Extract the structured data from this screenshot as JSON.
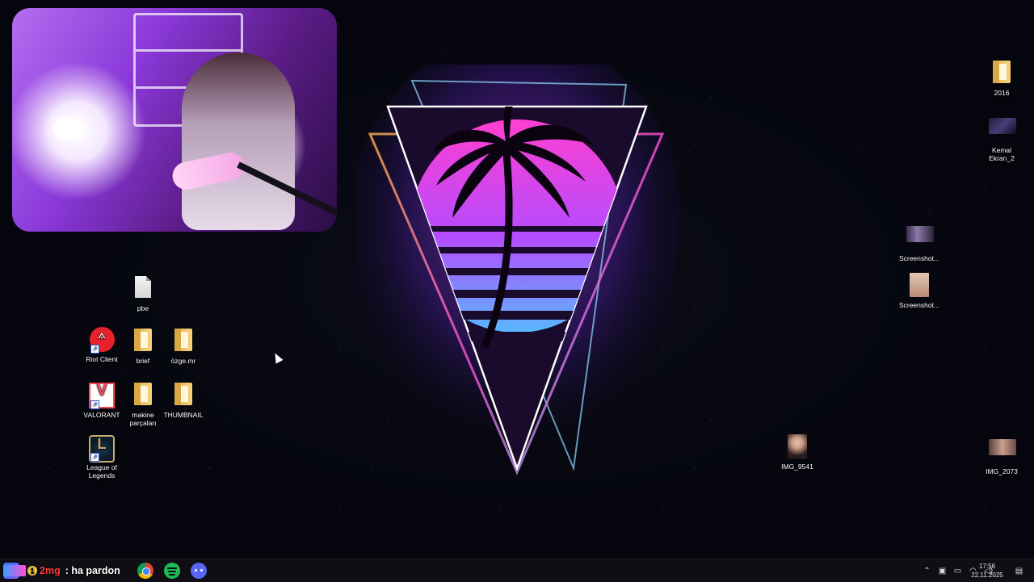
{
  "desktop_icons": {
    "pbe": {
      "label": "pbe",
      "icon": "file-icon"
    },
    "riot_client": {
      "label": "Riot Client",
      "icon": "riot-client-icon"
    },
    "brief": {
      "label": "brief",
      "icon": "folder-icon"
    },
    "ozge": {
      "label": "özge.mr",
      "icon": "folder-icon"
    },
    "valorant": {
      "label": "VALORANT",
      "icon": "valorant-icon"
    },
    "makine": {
      "label_line1": "makine",
      "label_line2": "parçaları",
      "icon": "folder-icon"
    },
    "thumbnail": {
      "label": "THUMBNAIL",
      "icon": "folder-icon"
    },
    "league": {
      "label_line1": "League of",
      "label_line2": "Legends",
      "icon": "league-of-legends-icon"
    },
    "folder_2016": {
      "label": "2016",
      "icon": "folder-icon"
    },
    "kemal": {
      "label_line1": "Kemal",
      "label_line2": "Ekran_2",
      "icon": "video-thumbnail-icon"
    },
    "screenshot_1": {
      "label": "Screenshot...",
      "icon": "image-thumbnail-icon"
    },
    "screenshot_2": {
      "label": "Screenshot...",
      "icon": "image-thumbnail-icon"
    },
    "img_9541": {
      "label": "IMG_9541",
      "icon": "image-thumbnail-icon"
    },
    "img_2073": {
      "label": "IMG_2073",
      "icon": "image-thumbnail-icon"
    }
  },
  "chat_overlay": {
    "badge_count": "1",
    "username": "2mg",
    "message": ": ha pardon"
  },
  "taskbar": {
    "apps": [
      "start-icon",
      "chrome-icon",
      "spotify-icon",
      "discord-icon"
    ],
    "tray": [
      "chevron-up-icon",
      "network-icon",
      "display-icon",
      "wifi-icon",
      "volume-icon"
    ],
    "time": "17:56",
    "date": "22.11.2025",
    "notification_icon": "notification-icon"
  },
  "colors": {
    "taskbar_bg": "#0e0e14",
    "accent_pink": "#ff2fd6",
    "accent_purple": "#9b4dff",
    "chrome_red": "#db4437",
    "spotify_green": "#1db954",
    "discord_blue": "#5865f2"
  }
}
